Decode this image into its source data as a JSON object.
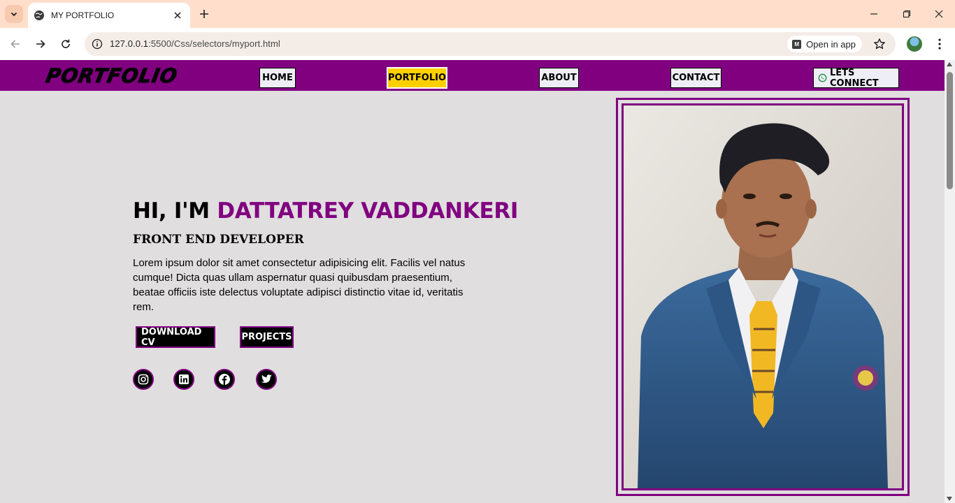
{
  "browser": {
    "tab_title": "MY PORTFOLIO",
    "url_host": "127.0.0.1",
    "url_rest": ":5500/Css/selectors/myport.html",
    "open_in_app": "Open in app"
  },
  "site": {
    "logo": "PORTFOLIO",
    "nav": {
      "home": "HOME",
      "portfolio": "PORTFOLIO",
      "about": "ABOUT",
      "contact": "CONTACT",
      "connect": "LETS CONNECT"
    },
    "hero": {
      "greeting": "HI, I'M ",
      "name": "DATTATREY VADDANKERI",
      "role": "FRONT END DEVELOPER",
      "bio": "Lorem ipsum dolor sit amet consectetur adipisicing elit. Facilis vel natus cumque! Dicta quas ullam aspernatur quasi quibusdam praesentium, beatae officiis iste delectus voluptate adipisci distinctio vitae id, veritatis rem.",
      "download_cv": "DOWNLOAD CV",
      "projects": "PROJECTS"
    },
    "social_icons": [
      "instagram-icon",
      "linkedin-icon",
      "facebook-icon",
      "twitter-icon"
    ]
  },
  "colors": {
    "brand": "#800080",
    "active_nav": "#ffd000",
    "page_bg": "#e0dedf",
    "tabbar_bg": "#ffdfcb"
  }
}
